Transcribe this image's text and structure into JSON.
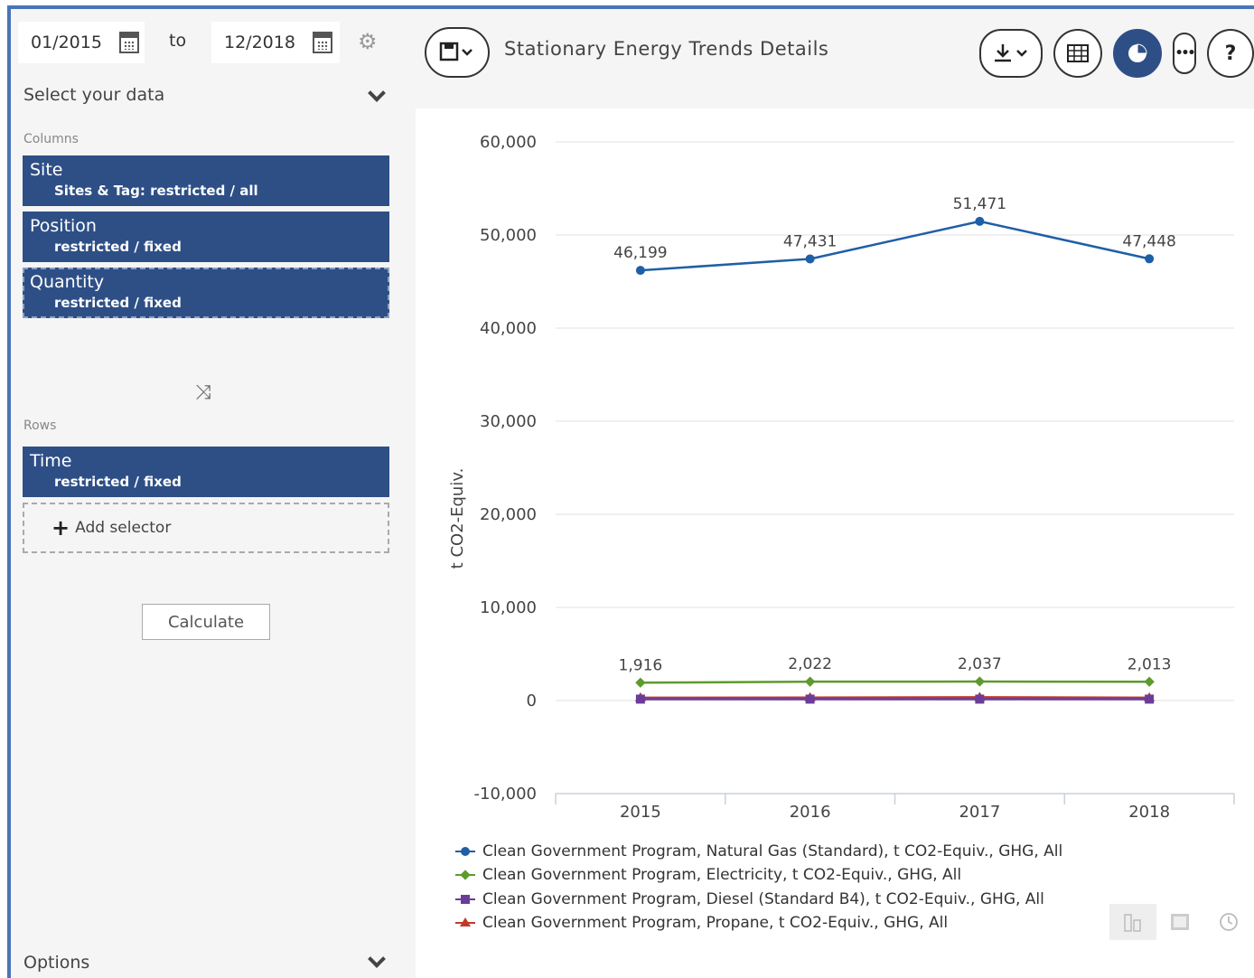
{
  "filters": {
    "date_from": "01/2015",
    "to_label": "to",
    "date_to": "12/2018"
  },
  "left_panel": {
    "select_data_label": "Select your data",
    "columns_label": "Columns",
    "columns": [
      {
        "title": "Site",
        "subtitle": "Sites & Tag: restricted / all"
      },
      {
        "title": "Position",
        "subtitle": "restricted / fixed"
      },
      {
        "title": "Quantity",
        "subtitle": "restricted / fixed"
      }
    ],
    "rows_label": "Rows",
    "rows": [
      {
        "title": "Time",
        "subtitle": "restricted / fixed"
      }
    ],
    "add_selector_label": "Add selector",
    "calculate_label": "Calculate",
    "options_label": "Options"
  },
  "header": {
    "title": "Stationary Energy Trends Details",
    "help_label": "?"
  },
  "icons": {
    "calendar": "calendar-icon",
    "settings": "gear-icon",
    "shuffle": "shuffle-icon",
    "save": "save-icon",
    "download": "download-icon",
    "table": "table-icon",
    "chart": "pie-chart-icon",
    "more": "more-icon",
    "help": "help-icon"
  },
  "colors": {
    "accent": "#2e4f86",
    "frame": "#4a74b8",
    "natural_gas": "#1f5fa6",
    "electricity": "#5e9a2c",
    "diesel": "#6a3d9a",
    "propane": "#c0392b"
  },
  "chart_data": {
    "type": "line",
    "title": "",
    "ylabel": "t CO2-Equiv.",
    "xlabel": "",
    "categories": [
      "2015",
      "2016",
      "2017",
      "2018"
    ],
    "ylim": [
      -10000,
      60000
    ],
    "yticks": [
      -10000,
      0,
      10000,
      20000,
      30000,
      40000,
      50000,
      60000
    ],
    "ytick_labels": [
      "-10,000",
      "0",
      "10,000",
      "20,000",
      "30,000",
      "40,000",
      "50,000",
      "60,000"
    ],
    "grid": true,
    "legend_position": "bottom-left",
    "series": [
      {
        "name": "Clean Government Program, Natural Gas (Standard), t CO2-Equiv., GHG, All",
        "values": [
          46199,
          47431,
          51471,
          47448
        ],
        "labels": [
          "46,199",
          "47,431",
          "51,471",
          "47,448"
        ],
        "marker": "circle",
        "color": "#1f5fa6"
      },
      {
        "name": "Clean Government Program, Electricity, t CO2-Equiv., GHG, All",
        "values": [
          1916,
          2022,
          2037,
          2013
        ],
        "labels": [
          "1,916",
          "2,022",
          "2,037",
          "2,013"
        ],
        "marker": "diamond",
        "color": "#5e9a2c"
      },
      {
        "name": "Clean Government Program, Diesel (Standard B4), t CO2-Equiv., GHG, All",
        "values": [
          150,
          150,
          150,
          150
        ],
        "labels": [],
        "marker": "square",
        "color": "#6a3d9a"
      },
      {
        "name": "Clean Government Program, Propane, t CO2-Equiv., GHG, All",
        "values": [
          300,
          320,
          350,
          300
        ],
        "labels": [],
        "marker": "triangle",
        "color": "#c0392b"
      }
    ]
  }
}
